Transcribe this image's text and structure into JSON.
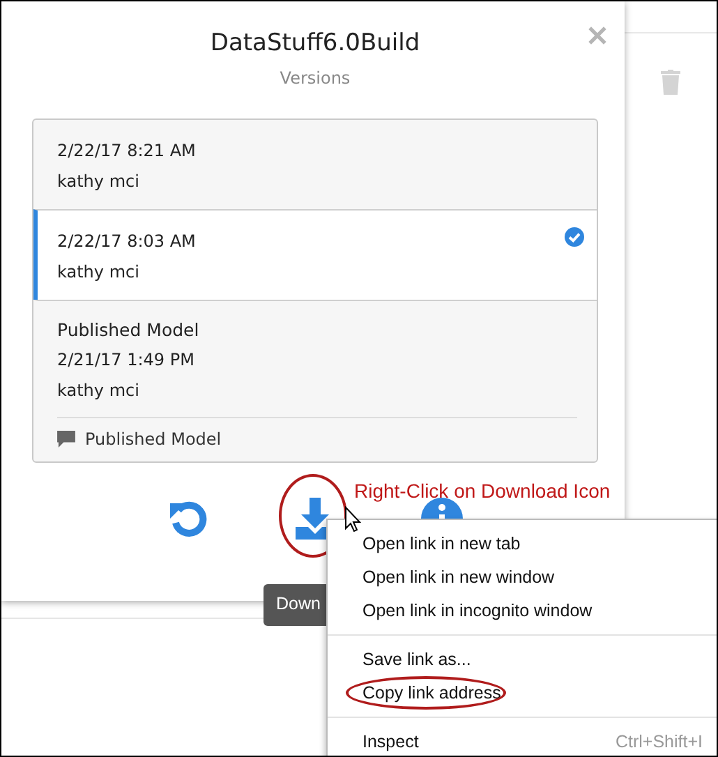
{
  "dialog": {
    "title": "DataStuff6.0Build",
    "subtitle": "Versions",
    "versions": [
      {
        "date": "2/22/17 8:21 AM",
        "author": "kathy mci",
        "selected": false
      },
      {
        "date": "2/22/17 8:03 AM",
        "author": "kathy mci",
        "selected": true
      },
      {
        "heading": "Published Model",
        "date": "2/21/17 1:49 PM",
        "author": "kathy mci",
        "comment": "Published Model",
        "selected": false
      }
    ],
    "actions": [
      {
        "kind": "restore",
        "circled": false
      },
      {
        "kind": "download",
        "circled": true
      },
      {
        "kind": "info",
        "circled": false
      }
    ],
    "tooltip": "Down"
  },
  "annotation": "Right-Click on Download Icon",
  "context_menu": {
    "groups": [
      {
        "items": [
          {
            "label": "Open link in new tab",
            "circled": false
          },
          {
            "label": "Open link in new window",
            "circled": false
          },
          {
            "label": "Open link in incognito window",
            "circled": false
          }
        ]
      },
      {
        "items": [
          {
            "label": "Save link as...",
            "circled": false
          },
          {
            "label": "Copy link address",
            "circled": true
          }
        ]
      },
      {
        "items": [
          {
            "label": "Inspect",
            "shortcut": "Ctrl+Shift+I",
            "circled": false
          }
        ]
      }
    ]
  }
}
